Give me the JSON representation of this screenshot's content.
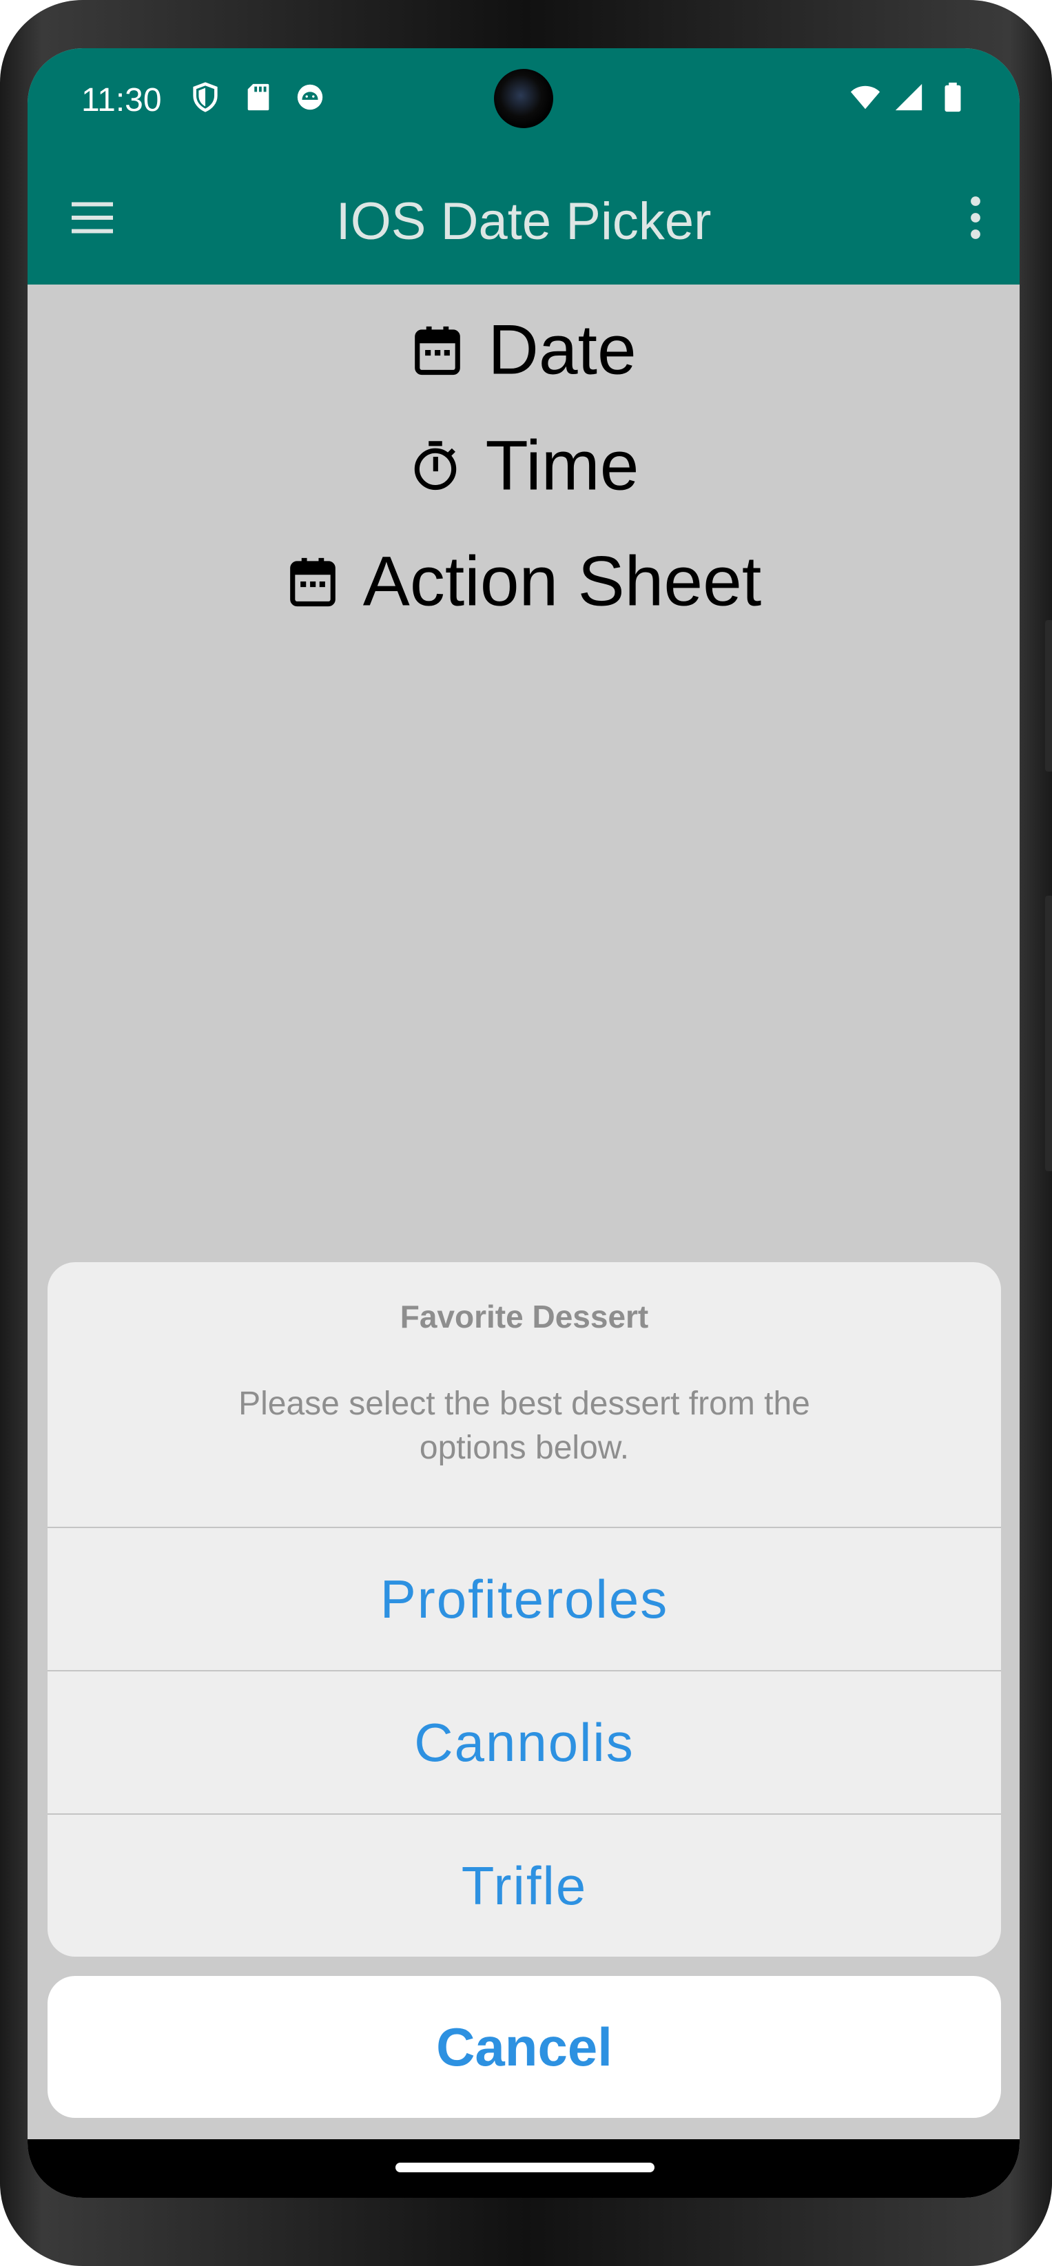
{
  "status_bar": {
    "time": "11:30",
    "icons_left": [
      "shield-icon",
      "sd-card-icon",
      "android-robot-icon"
    ],
    "icons_right": [
      "wifi-icon",
      "signal-icon",
      "battery-icon"
    ]
  },
  "app_bar": {
    "title": "IOS Date Picker",
    "color": "#00766c"
  },
  "main": {
    "items": [
      {
        "label": "Date",
        "icon": "calendar-icon"
      },
      {
        "label": "Time",
        "icon": "timer-icon"
      },
      {
        "label": "Action Sheet",
        "icon": "calendar-icon"
      }
    ]
  },
  "action_sheet": {
    "title": "Favorite Dessert",
    "message": "Please select the best dessert from the options below.",
    "options": [
      "Profiteroles",
      "Cannolis",
      "Trifle"
    ],
    "cancel_label": "Cancel",
    "accent_color": "#2d91e1"
  }
}
